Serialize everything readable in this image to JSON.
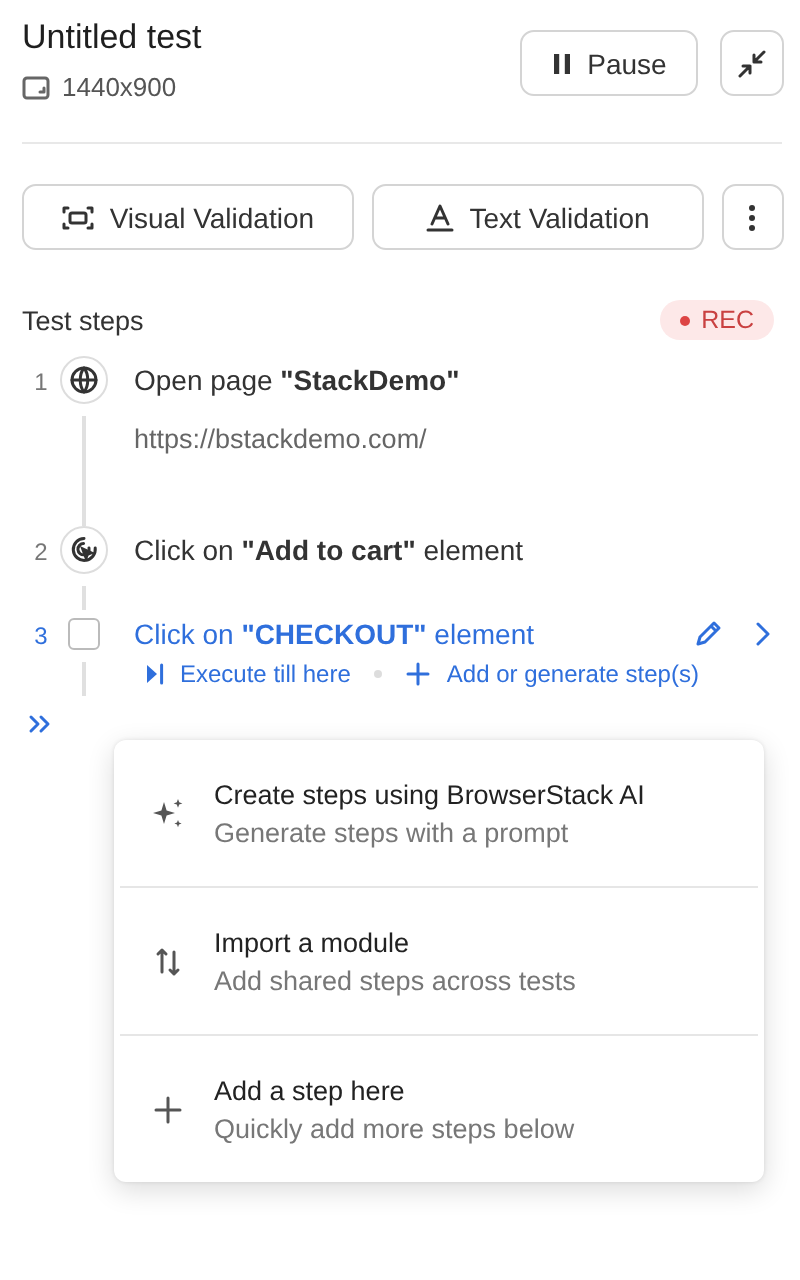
{
  "header": {
    "title": "Untitled test",
    "resolution": "1440x900",
    "pause_label": "Pause"
  },
  "validation_buttons": [
    {
      "kind": "visual",
      "label": "Visual Validation"
    },
    {
      "kind": "text",
      "label": "Text Validation"
    }
  ],
  "steps_section": {
    "title": "Test steps",
    "recording": true,
    "badge": "REC"
  },
  "steps": [
    {
      "number": "1",
      "kind": "globe",
      "title": "Open page **\"StackDemo\"**",
      "detail": "https://bstackdemo.com/",
      "selected": false
    },
    {
      "number": "2",
      "kind": "cursor",
      "title": "Click on **\"Add to cart\"** element",
      "selected": false
    },
    {
      "number": "3",
      "kind": "checkbox",
      "title": "Click on **\"CHECKOUT\"** element",
      "selected": true,
      "checked": false,
      "actions": [
        "Execute till here",
        "Add or generate step(s)"
      ]
    }
  ],
  "menu": {
    "items": [
      {
        "kind": "sparkle",
        "title": "Create steps using BrowserStack AI",
        "subtitle": "Generate steps with a prompt"
      },
      {
        "kind": "import",
        "title": "Import a module",
        "subtitle": "Add shared steps across tests"
      },
      {
        "kind": "plus",
        "title": "Add a step here",
        "subtitle": "Quickly add more steps below"
      }
    ]
  }
}
